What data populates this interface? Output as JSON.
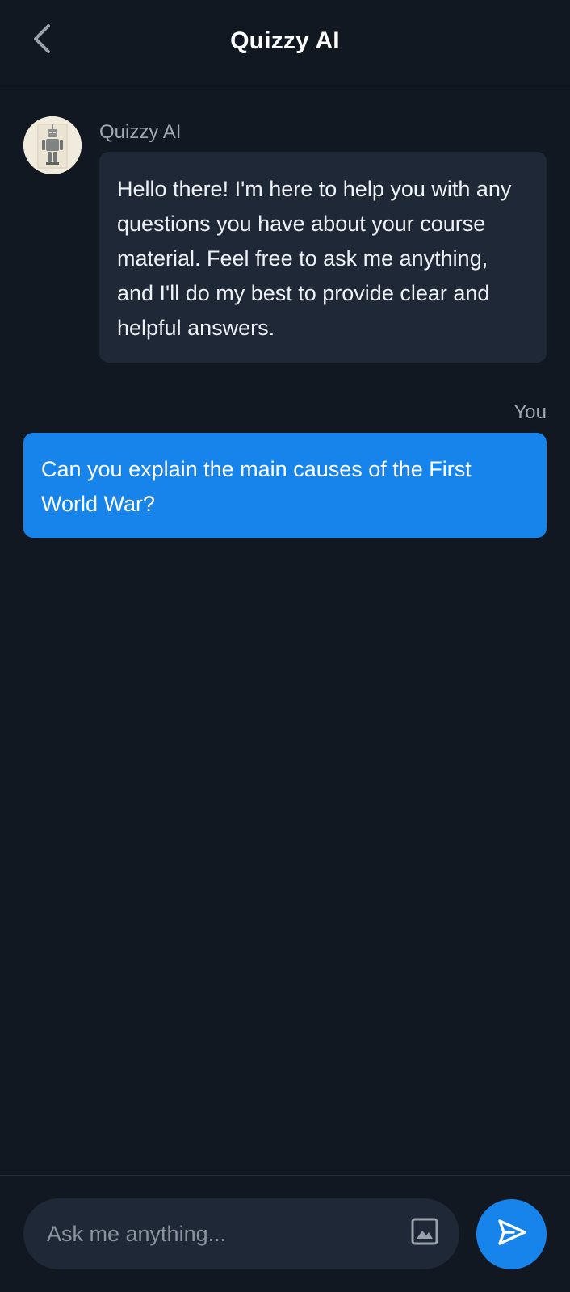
{
  "header": {
    "title": "Quizzy AI",
    "back_icon": "chevron-left-icon"
  },
  "messages": [
    {
      "sender": "Quizzy AI",
      "avatar_icon": "robot-avatar",
      "text": "Hello there! I'm here to help you with any questions you have about your course material. Feel free to ask me anything, and I'll do my best to provide clear and helpful answers."
    },
    {
      "sender": "You",
      "text": "Can you explain the main causes of the First World War?"
    }
  ],
  "composer": {
    "placeholder": "Ask me anything...",
    "image_icon": "image-icon",
    "send_icon": "send-icon"
  },
  "colors": {
    "background": "#111821",
    "ai_bubble": "#1e2836",
    "user_bubble": "#1684ea",
    "accent": "#1684ea",
    "muted_text": "#a1a8b3"
  }
}
